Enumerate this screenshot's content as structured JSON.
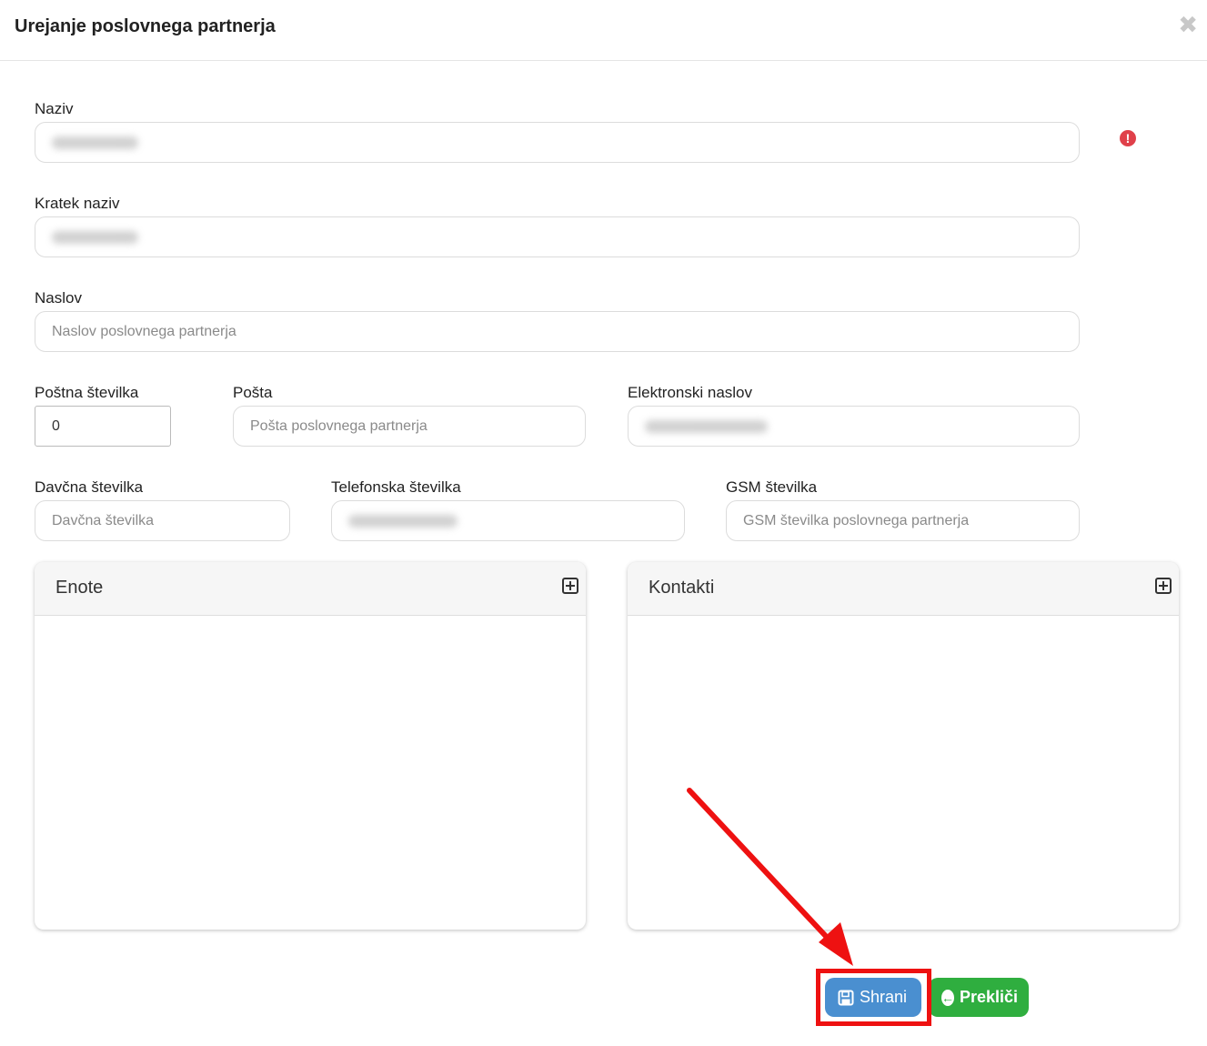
{
  "modal": {
    "title": "Urejanje poslovnega partnerja",
    "close_glyph": "✖"
  },
  "fields": {
    "naziv": {
      "label": "Naziv"
    },
    "kratek_naziv": {
      "label": "Kratek naziv"
    },
    "naslov": {
      "label": "Naslov",
      "placeholder": "Naslov poslovnega partnerja"
    },
    "postna_stevilka": {
      "label": "Poštna številka",
      "value": "0"
    },
    "posta": {
      "label": "Pošta",
      "placeholder": "Pošta poslovnega partnerja"
    },
    "elektronski_naslov": {
      "label": "Elektronski naslov"
    },
    "davcna_stevilka": {
      "label": "Davčna številka",
      "placeholder": "Davčna številka"
    },
    "telefonska_stevilka": {
      "label": "Telefonska številka"
    },
    "gsm_stevilka": {
      "label": "GSM številka",
      "placeholder": "GSM številka poslovnega partnerja"
    }
  },
  "panels": {
    "enote": {
      "title": "Enote"
    },
    "kontakti": {
      "title": "Kontakti"
    }
  },
  "buttons": {
    "save": {
      "label": "Shrani"
    },
    "cancel": {
      "label": "Prekliči"
    }
  },
  "icons": {
    "error": "exclamation-circle-icon",
    "add": "plus-square-icon",
    "save": "floppy-disk-icon",
    "cancel": "arrow-circle-left-icon"
  },
  "colors": {
    "save_button": "#4a8fd0",
    "cancel_button": "#2fae3f",
    "error": "#e0404a",
    "annotation": "#ee1111"
  }
}
